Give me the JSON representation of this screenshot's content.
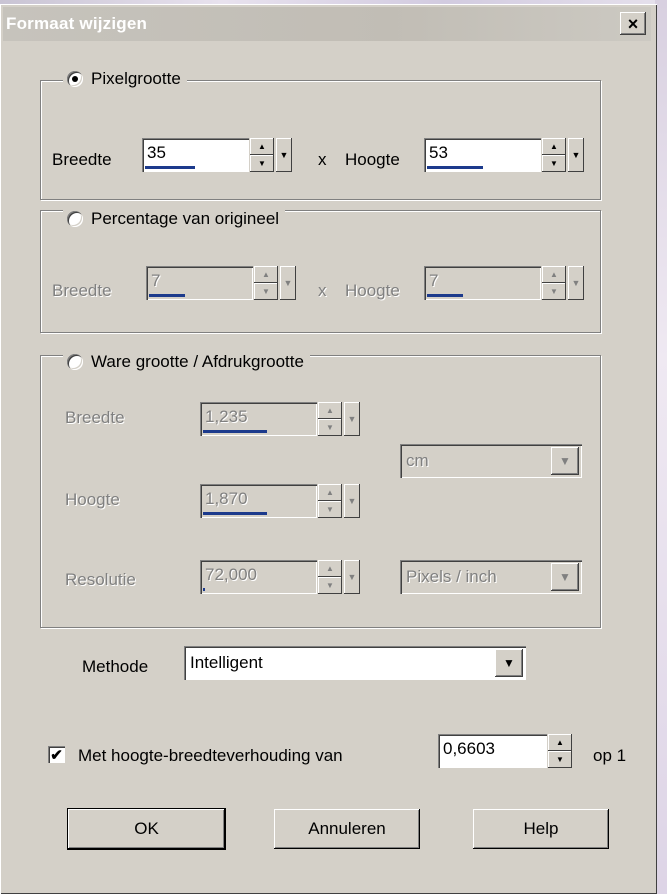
{
  "window": {
    "title": "Formaat wijzigen",
    "close_glyph": "×"
  },
  "pixel_size": {
    "label": "Pixelgrootte",
    "selected": true,
    "width_label": "Breedte",
    "width_value": "35",
    "separator": "x",
    "height_label": "Hoogte",
    "height_value": "53"
  },
  "percentage": {
    "label": "Percentage van origineel",
    "selected": false,
    "width_label": "Breedte",
    "width_value": "7",
    "separator": "x",
    "height_label": "Hoogte",
    "height_value": "7"
  },
  "actual_size": {
    "label": "Ware grootte / Afdrukgrootte",
    "selected": false,
    "width_label": "Breedte",
    "width_value": "1,235",
    "height_label": "Hoogte",
    "height_value": "1,870",
    "resolution_label": "Resolutie",
    "resolution_value": "72,000",
    "unit_value": "cm",
    "resolution_unit_value": "Pixels / inch"
  },
  "method": {
    "label": "Methode",
    "value": "Intelligent"
  },
  "aspect": {
    "checked": true,
    "label": "Met hoogte-breedteverhouding van",
    "value": "0,6603",
    "suffix": "op 1"
  },
  "buttons": {
    "ok": "OK",
    "cancel": "Annuleren",
    "help": "Help"
  },
  "icons": {
    "spin_up": "▲",
    "spin_down": "▼",
    "dropdown": "▼",
    "check": "✔"
  }
}
